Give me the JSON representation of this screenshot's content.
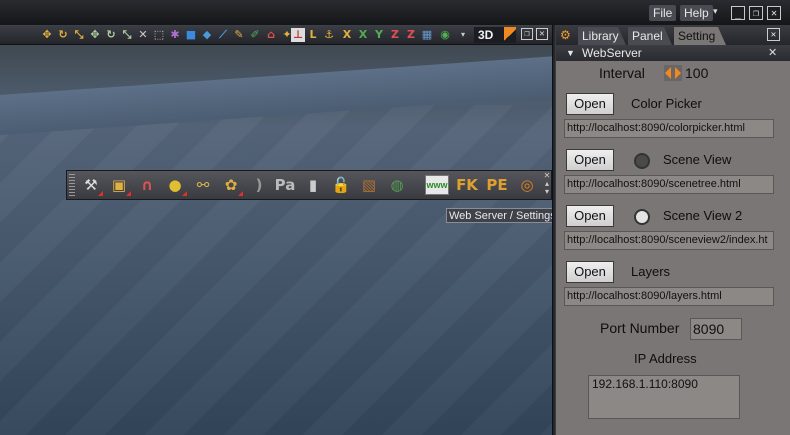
{
  "menubar": {
    "file": "File",
    "help": "Help",
    "menu_arrow": "▾",
    "minimize": "_",
    "restore": "❐",
    "close": "✕"
  },
  "viewport": {
    "mode_label": "3D",
    "toolbar_icons": [
      "move",
      "rotate",
      "scale",
      "move-x",
      "rotate-x",
      "scale-x",
      "select",
      "cube",
      "paint",
      "knife",
      "brush",
      "home",
      "axis",
      "L",
      "lock",
      "X",
      "Y",
      "Z",
      "grid",
      "camera"
    ],
    "close": "✕",
    "restore": "❐"
  },
  "shelf": {
    "icons": [
      "tool",
      "box",
      "magnet",
      "balls",
      "link",
      "ribbon",
      "bracket",
      "Pa",
      "scroll",
      "padlock",
      "square",
      "dish",
      "www",
      "FK",
      "PE",
      "power"
    ],
    "fk_label": "FK",
    "pe_label": "PE",
    "www_label": "www",
    "pa_label": "Pa"
  },
  "tooltip": "Web Server / Settings",
  "panel": {
    "tabs": [
      "Library",
      "Panel",
      "Setting"
    ],
    "active_tab": "Setting",
    "close": "✕",
    "section_title": "WebServer",
    "section_close": "✕",
    "interval_label": "Interval",
    "interval_value": "100",
    "entries": [
      {
        "button": "Open",
        "name": "Color Picker",
        "url": "http://localhost:8090/colorpicker.html",
        "indicator": "none"
      },
      {
        "button": "Open",
        "name": "Scene View",
        "url": "http://localhost:8090/scenetree.html",
        "indicator": "dark"
      },
      {
        "button": "Open",
        "name": "Scene View 2",
        "url": "http://localhost:8090/sceneview2/index.ht",
        "indicator": "light"
      },
      {
        "button": "Open",
        "name": "Layers",
        "url": "http://localhost:8090/layers.html",
        "indicator": "none"
      }
    ],
    "port_label": "Port Number",
    "port_value": "8090",
    "ip_label": "IP Address",
    "ip_value": "192.168.1.110:8090"
  },
  "colors": {
    "panel_bg": "#7a7675",
    "accent_orange": "#f08a20",
    "indicator_dark": "#4a4a4a",
    "indicator_light": "#e4e4e4"
  }
}
